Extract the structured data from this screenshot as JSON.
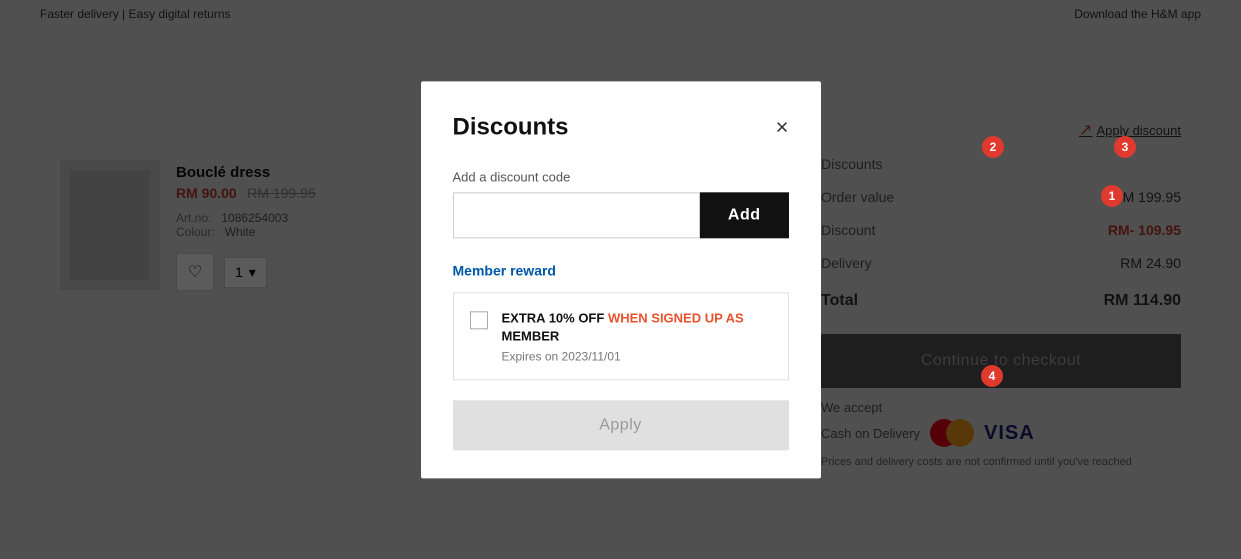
{
  "topbar": {
    "left": "Faster delivery | Easy digital returns",
    "right": "Download the H&M app"
  },
  "product": {
    "name": "Bouclé dress",
    "price_sale": "RM 90.00",
    "price_original": "RM 199.95",
    "art_no_label": "Art.no.",
    "art_no_value": "1086254003",
    "colour_label": "Colour:",
    "colour_value": "White",
    "quantity": "1"
  },
  "order_summary": {
    "apply_discount_link": "Apply discount",
    "rows": [
      {
        "label": "Discounts",
        "value": "",
        "type": "label"
      },
      {
        "label": "Order value",
        "value": "RM 199.95",
        "type": "normal"
      },
      {
        "label": "Discount",
        "value": "RM- 109.95",
        "type": "red"
      },
      {
        "label": "Delivery",
        "value": "RM 24.90",
        "type": "normal"
      },
      {
        "label": "Total",
        "value": "RM 114.90",
        "type": "total"
      }
    ],
    "checkout_btn": "Continue to checkout",
    "we_accept": "We accept",
    "cash_on_delivery": "Cash on Delivery",
    "fine_print": "Prices and delivery costs are not confirmed until you've reached"
  },
  "modal": {
    "title": "Discounts",
    "close_label": "×",
    "discount_section_label": "Add a discount code",
    "discount_input_placeholder": "",
    "add_btn_label": "Add",
    "member_reward_label": "Member reward",
    "reward": {
      "title_part1": "EXTRA 10% OFF ",
      "title_highlight": "WHEN SIGNED UP AS",
      "title_part2": " MEMBER",
      "expiry": "Expires on 2023/11/01"
    },
    "apply_btn_label": "Apply"
  },
  "badges": {
    "b1": "1",
    "b2": "2",
    "b3": "3",
    "b4": "4"
  }
}
